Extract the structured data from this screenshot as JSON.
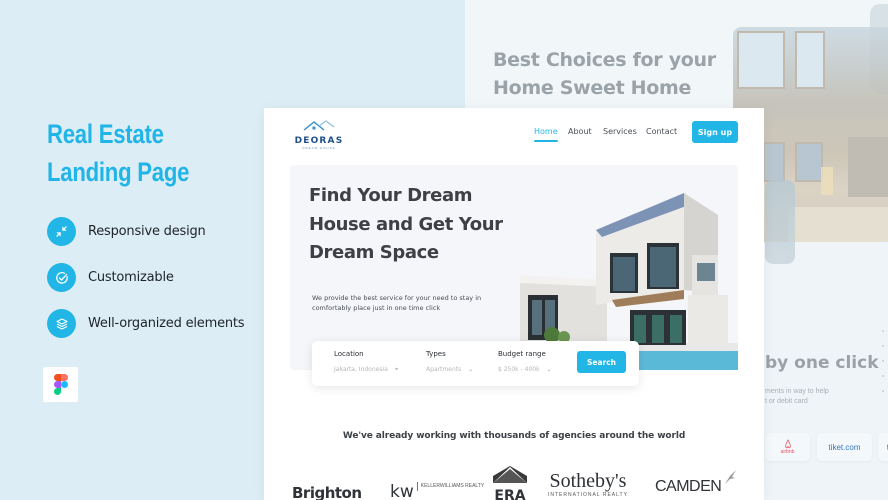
{
  "left_panel": {
    "title_line1": "Real Estate",
    "title_line2": "Landing Page",
    "features": [
      {
        "icon": "collapse-arrows-icon",
        "label": "Responsive design"
      },
      {
        "icon": "check-circle-icon",
        "label": "Customizable"
      },
      {
        "icon": "layers-icon",
        "label": "Well-organized elements"
      }
    ],
    "tool_icon": "figma-icon"
  },
  "background_preview": {
    "title_line1": "Best Choices for your",
    "title_line2": "Home Sweet Home",
    "section_heading": "by one click",
    "section_sub_line1": "ments in way to help",
    "section_sub_line2": "t or debit card",
    "payment_partners": [
      "airbnb",
      "tiket.com",
      "t"
    ]
  },
  "landing": {
    "logo": {
      "name": "DEORAS",
      "tagline": "DREAM HOUSE"
    },
    "nav": [
      {
        "label": "Home",
        "active": true
      },
      {
        "label": "About",
        "active": false
      },
      {
        "label": "Services",
        "active": false
      },
      {
        "label": "Contact",
        "active": false
      }
    ],
    "signup_label": "Sign up",
    "hero": {
      "title": "Find Your Dream House and Get Your Dream Space",
      "subtitle": "We provide the best service for your need to stay in comfortably place just in one time click"
    },
    "search": {
      "fields": [
        {
          "label": "Location",
          "value": "Jakarta, Indonesia",
          "icon": "target-icon"
        },
        {
          "label": "Types",
          "value": "Apartments",
          "icon": "chevron-down-icon"
        },
        {
          "label": "Budget range",
          "value": "$ 250k - 400k",
          "icon": "chevron-down-icon"
        }
      ],
      "button_label": "Search"
    },
    "agencies_heading": "We've already working with thousands of agencies around the world",
    "brands": [
      "Brighton",
      "KELLERWILLIAMS REALTY",
      "ERA",
      "Sotheby's",
      "CAMDEN"
    ],
    "brand_subs": {
      "kw": "kw",
      "sothebys_sub": "INTERNATIONAL REALTY"
    }
  },
  "colors": {
    "accent": "#21b6e6",
    "page_bg": "#dcedf5",
    "heading_dark": "#3e4046"
  }
}
